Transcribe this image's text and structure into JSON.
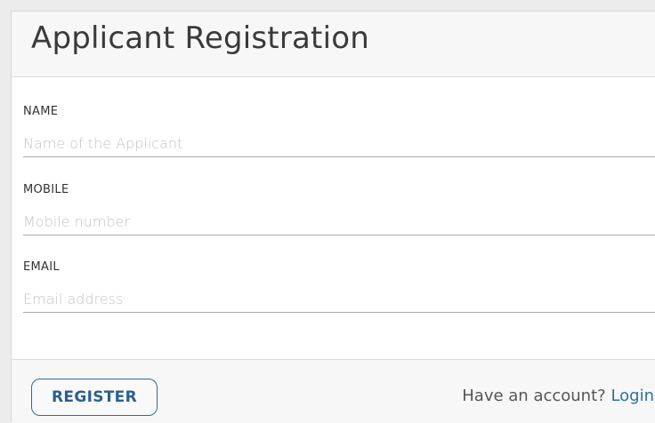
{
  "header": {
    "title": "Applicant Registration"
  },
  "form": {
    "fields": [
      {
        "label": "NAME",
        "placeholder": "Name of the Applicant",
        "value": ""
      },
      {
        "label": "MOBILE",
        "placeholder": "Mobile number",
        "value": ""
      },
      {
        "label": "EMAIL",
        "placeholder": "Email address",
        "value": ""
      }
    ]
  },
  "footer": {
    "register_label": "REGISTER",
    "account_prompt": "Have an account?",
    "login_label": "Login"
  },
  "colors": {
    "accent": "#2a6fa8",
    "header_bg": "#f7f7f7",
    "border": "#dcdcdc"
  }
}
